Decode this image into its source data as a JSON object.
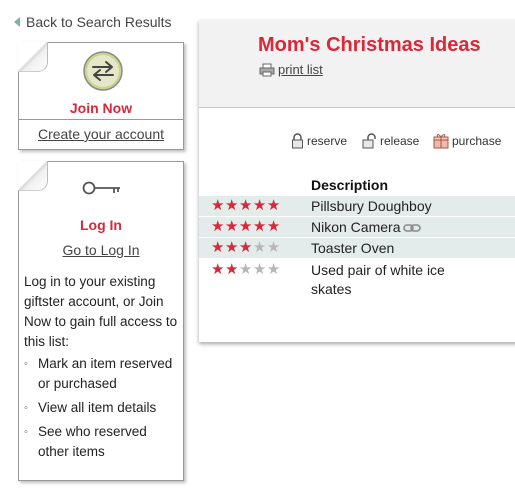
{
  "nav": {
    "back_label": "Back to Search Results"
  },
  "join": {
    "title": "Join Now",
    "link": "Create your account"
  },
  "login": {
    "title": "Log In",
    "link": "Go to Log In",
    "body": "Log in to your existing giftster account, or Join Now to gain full access to this list:",
    "bullets": [
      "Mark an item reserved or purchased",
      "View all item details",
      "See who reserved other items"
    ]
  },
  "list": {
    "title": "Mom's Christmas Ideas",
    "print_label": "print list",
    "legend": {
      "reserve": "reserve",
      "release": "release",
      "purchase": "purchase"
    },
    "column_header": "Description",
    "items": [
      {
        "description": "Pillsbury Doughboy",
        "rating": 5,
        "has_link": false
      },
      {
        "description": "Nikon Camera",
        "rating": 5,
        "has_link": true
      },
      {
        "description": "Toaster Oven",
        "rating": 3,
        "has_link": false
      },
      {
        "description": "Used pair of white ice skates",
        "rating": 2,
        "has_link": false
      }
    ]
  },
  "colors": {
    "accent": "#d8283a",
    "row_shade": "#e3ecea",
    "star_off": "#b7b7b7",
    "back_arrow": "#7ab3a8"
  }
}
